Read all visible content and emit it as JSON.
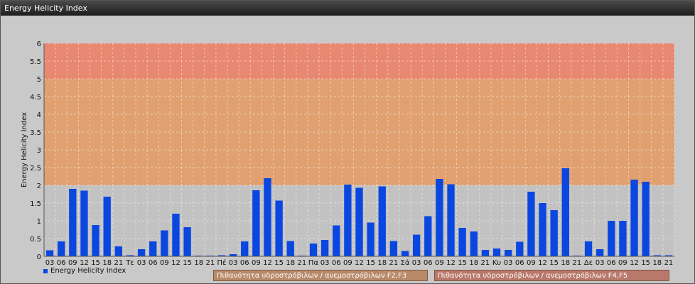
{
  "window": {
    "title": "Energy Helicity Index"
  },
  "colors": {
    "bar": "#0a47e0",
    "zone_low": "#c2c2c2",
    "zone_mid": "#e0a070",
    "zone_high": "#e88872"
  },
  "legend": {
    "series_label": "Energy Helicity Index",
    "zone_mid_label": "Πιθανότητα υδροστρόβιλων / ανεμοστρόβιλων F2,F3",
    "zone_high_label": "Πιθανότητα υδροστρόβιλων / ανεμοστρόβιλων F4,F5"
  },
  "chart_data": {
    "type": "bar",
    "title": "",
    "xlabel": "",
    "ylabel": "Energy Helicity Index",
    "ylim": [
      0,
      6
    ],
    "yticks": [
      "0",
      "0.5",
      "1",
      "1.5",
      "2",
      "2.5",
      "3",
      "3.5",
      "4",
      "4.5",
      "5",
      "5.5",
      "6"
    ],
    "grid": true,
    "zones": [
      {
        "from": 0,
        "to": 2,
        "color": "#c2c2c2"
      },
      {
        "from": 2,
        "to": 5,
        "color": "#e0a070"
      },
      {
        "from": 5,
        "to": 6,
        "color": "#e88872"
      }
    ],
    "categories": [
      "03",
      "06",
      "09",
      "12",
      "15",
      "18",
      "21",
      "Τε",
      "03",
      "06",
      "09",
      "12",
      "15",
      "18",
      "21",
      "Πέ",
      "03",
      "06",
      "09",
      "12",
      "15",
      "18",
      "21",
      "Πα",
      "03",
      "06",
      "09",
      "12",
      "15",
      "18",
      "21",
      "Σά",
      "03",
      "06",
      "09",
      "12",
      "15",
      "18",
      "21",
      "Κυ",
      "03",
      "06",
      "09",
      "12",
      "15",
      "18",
      "21",
      "Δε",
      "03",
      "06",
      "09",
      "12",
      "15",
      "18",
      "21"
    ],
    "series": [
      {
        "name": "Energy Helicity Index",
        "values": [
          0.17,
          0.42,
          1.9,
          1.85,
          0.88,
          1.68,
          0.28,
          0.03,
          0.2,
          0.42,
          0.73,
          1.2,
          0.82,
          0.02,
          0.02,
          0.03,
          0.06,
          0.42,
          1.86,
          2.2,
          1.57,
          0.43,
          0.02,
          0.36,
          0.46,
          0.87,
          2.02,
          1.93,
          0.95,
          1.97,
          0.43,
          0.15,
          0.61,
          1.13,
          2.18,
          2.03,
          0.8,
          0.7,
          0.18,
          0.22,
          0.18,
          0.41,
          1.82,
          1.5,
          1.3,
          2.48,
          0.02,
          0.42,
          0.2,
          1.0,
          1.0,
          2.16,
          2.1,
          0.03,
          0.03
        ]
      }
    ]
  }
}
